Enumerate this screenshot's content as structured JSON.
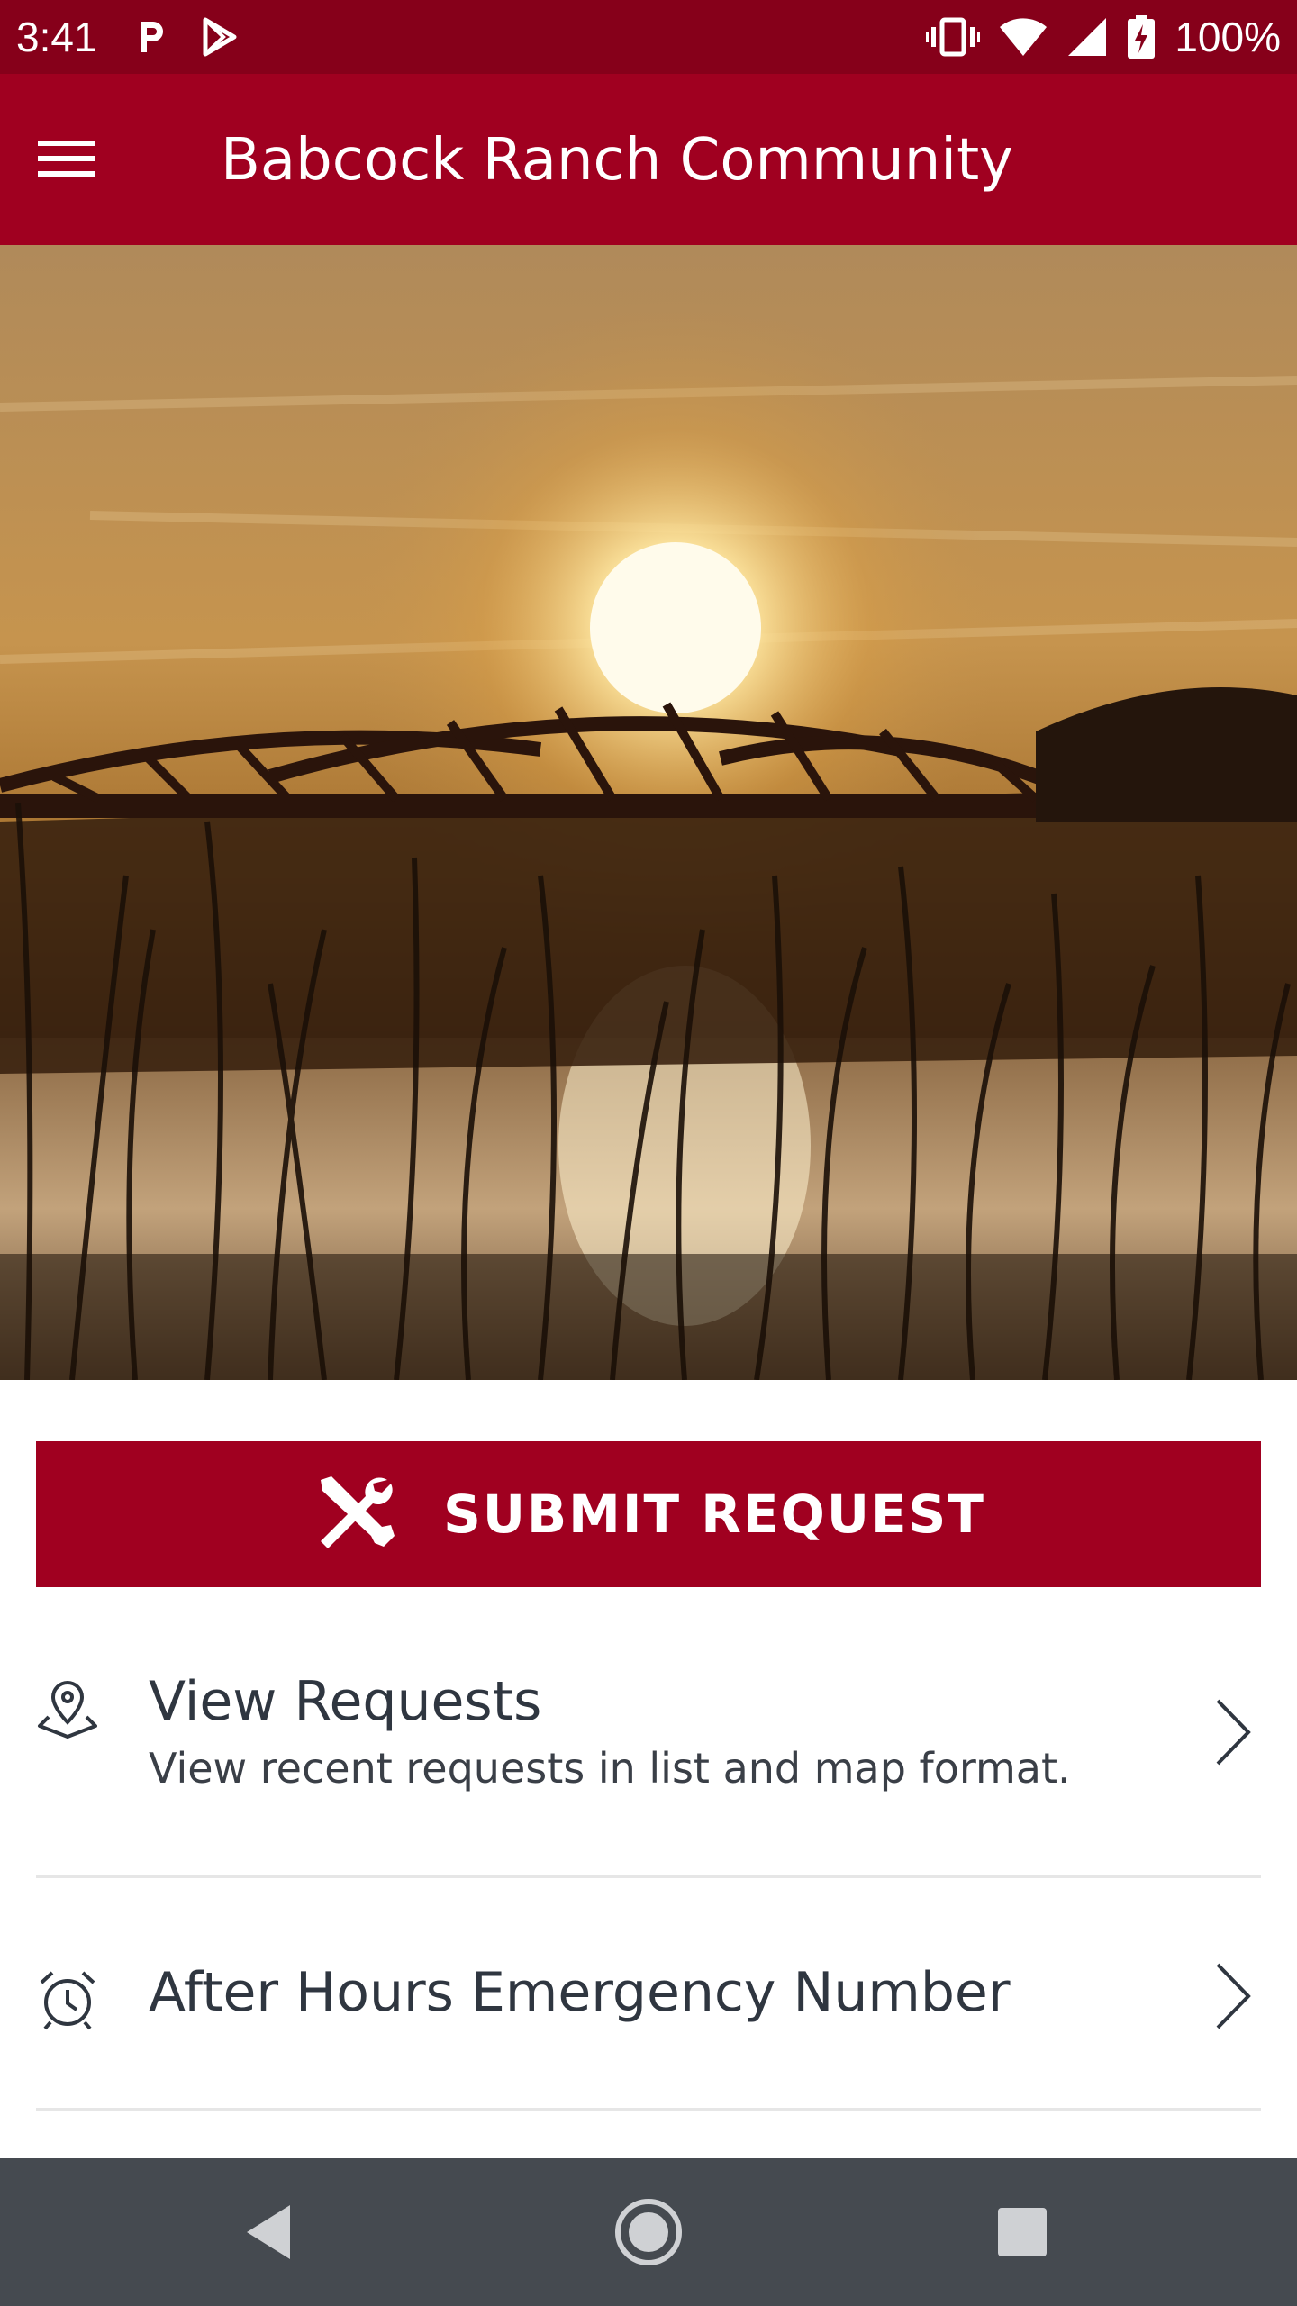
{
  "status_bar": {
    "time": "3:41",
    "battery": "100%",
    "icons": [
      "parking-icon",
      "play-store-icon",
      "vibrate-icon",
      "wifi-icon",
      "signal-icon",
      "battery-charging-icon"
    ]
  },
  "app_bar": {
    "title": "Babcock Ranch Community",
    "menu_icon": "hamburger-menu-icon"
  },
  "hero": {
    "icon": "sunset-bridge-photo"
  },
  "submit": {
    "label": "SUBMIT REQUEST",
    "icon": "tools-icon"
  },
  "menu": {
    "items": [
      {
        "title": "View Requests",
        "subtitle": "View recent requests in list and map format.",
        "icon": "map-pin-icon"
      },
      {
        "title": "After Hours Emergency Number",
        "icon": "alarm-clock-icon"
      }
    ]
  },
  "nav": {
    "icons": [
      "back-icon",
      "home-icon",
      "recents-icon"
    ]
  },
  "colors": {
    "brand": "#a00020",
    "status_bar": "#86001a",
    "nav_bar": "#454a50",
    "text": "#2f3640"
  }
}
